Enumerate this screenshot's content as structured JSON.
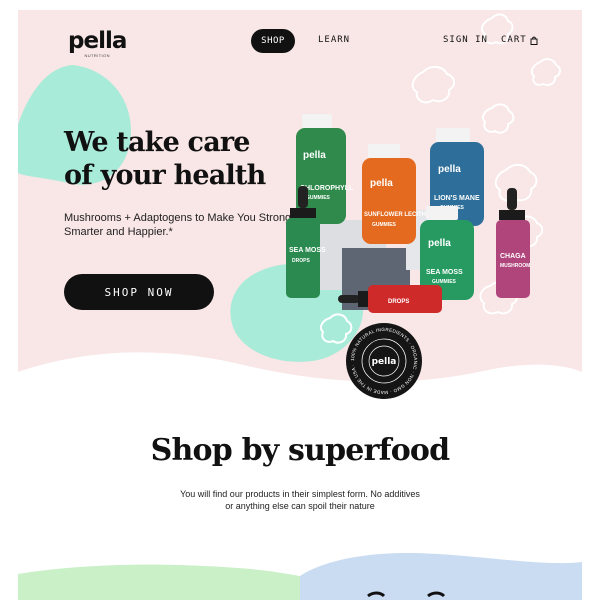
{
  "brand": {
    "name": "pella",
    "tagline": "NUTRITION"
  },
  "nav": {
    "shop": "SHOP",
    "learn": "LEARN",
    "sign_in": "SIGN IN",
    "cart": "CART"
  },
  "hero": {
    "title_line1": "We take care",
    "title_line2": "of your health",
    "subtitle": "Mushrooms + Adaptogens to Make You Stronger, Smarter and Happier.*",
    "cta": "SHOP NOW"
  },
  "products": [
    {
      "brand": "pella",
      "name": "CHLOROPHYLL",
      "type": "GUMMIES",
      "color": "#2f8a4c"
    },
    {
      "brand": "pella",
      "name": "SUNFLOWER LECITHIN",
      "type": "GUMMIES",
      "color": "#e36a1f"
    },
    {
      "brand": "pella",
      "name": "LION'S MANE",
      "type": "GUMMIES",
      "color": "#2d6f9a"
    },
    {
      "brand": "pella",
      "name": "SEA MOSS",
      "type": "GUMMIES",
      "color": "#279a62"
    },
    {
      "brand": "pella",
      "name": "SEA MOSS",
      "type": "DROPS",
      "color": "#2a8a4f"
    },
    {
      "brand": "pella",
      "name": "CHAGA",
      "type": "MUSHROOM",
      "color": "#b0457c"
    },
    {
      "brand": "pella",
      "name": "",
      "type": "DROPS",
      "color": "#cf2a2a"
    }
  ],
  "badge": {
    "text": "100% NATURAL INGREDIENTS · ORGANIC · NON GMO · MADE IN THE USA · GLUTEN FREE · 100% VEGAN ·",
    "center": "pella"
  },
  "section": {
    "title": "Shop by superfood",
    "subtitle": "You will find our products in their simplest form. No additives or anything else can spoil their nature"
  },
  "colors": {
    "hero_bg": "#f9e6e6",
    "mint": "#a8ebd9",
    "ink": "#111111",
    "bottom_green": "#c9f0c6",
    "bottom_blue": "#c9dcf2"
  }
}
